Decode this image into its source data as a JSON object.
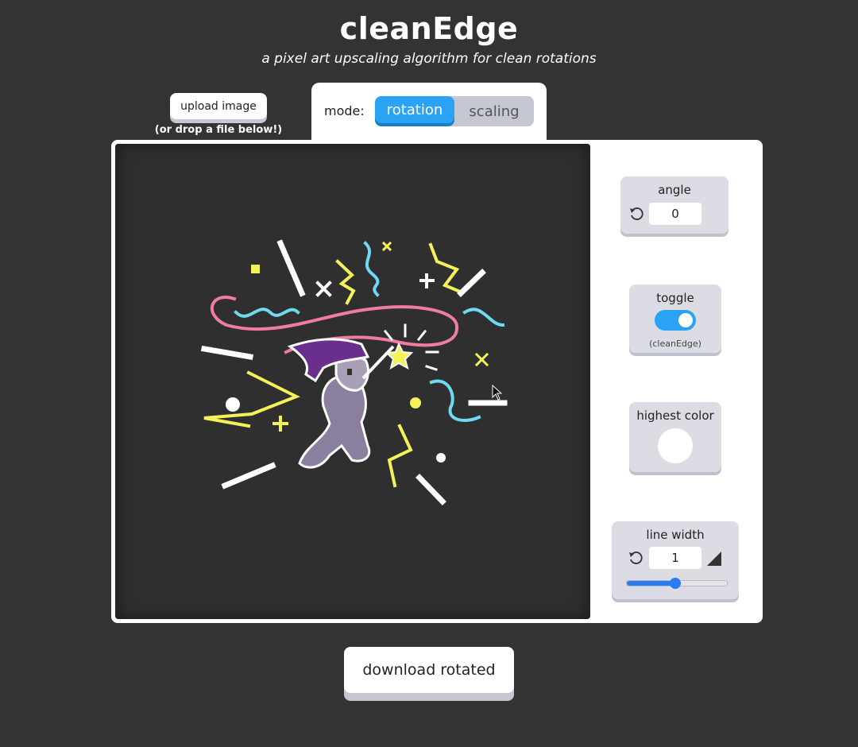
{
  "header": {
    "title": "cleanEdge",
    "subtitle": "a pixel art upscaling algorithm for clean rotations"
  },
  "upload": {
    "button_label": "upload image",
    "hint": "(or drop a file below!)"
  },
  "mode": {
    "label": "mode:",
    "options": [
      "rotation",
      "scaling"
    ],
    "selected": "rotation"
  },
  "controls": {
    "angle": {
      "label": "angle",
      "value": "0"
    },
    "toggle": {
      "label": "toggle",
      "state": "on",
      "sublabel": "(cleanEdge)"
    },
    "highest_color": {
      "label": "highest color",
      "color": "#ffffff"
    },
    "line_width": {
      "label": "line width",
      "value": "1",
      "slider_fraction": 0.49
    }
  },
  "download": {
    "label": "download rotated"
  },
  "colors": {
    "accent": "#2aa3f5",
    "background": "#333333",
    "panel": "#ffffff",
    "card": "#dcdde4",
    "art_yellow": "#f4f15a",
    "art_cyan": "#6fd9f2",
    "art_pink": "#f07ca4",
    "art_purple": "#6a2f8c"
  },
  "icons": {
    "reset": "reset-icon",
    "line_width": "triangle-corner-icon",
    "cursor": "mouse-cursor-icon"
  }
}
